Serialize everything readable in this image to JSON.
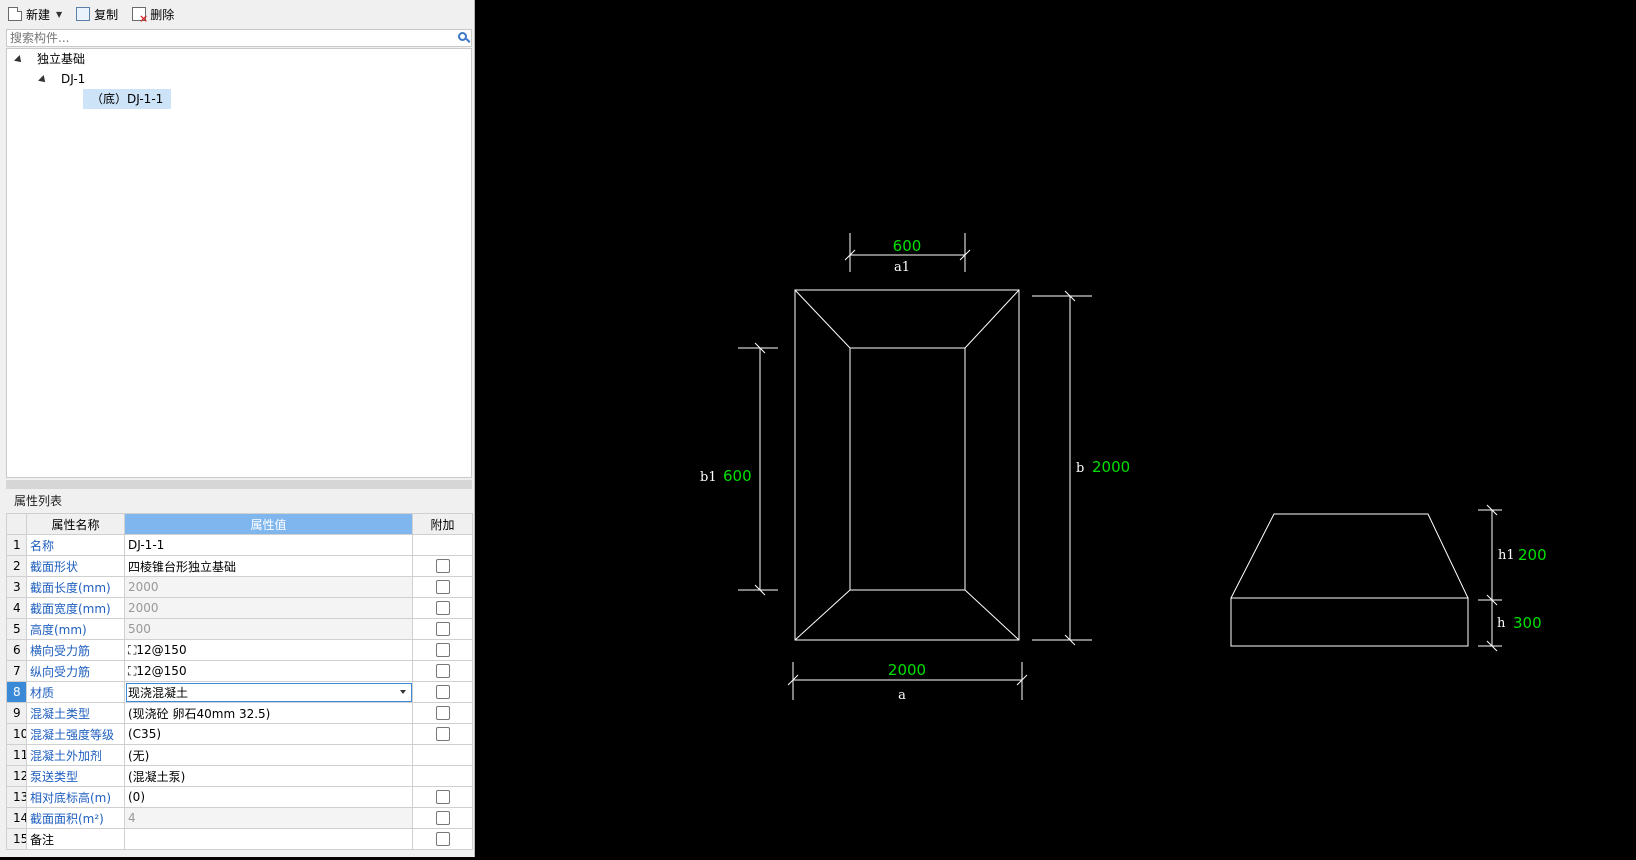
{
  "toolbar": {
    "new_label": "新建",
    "copy_label": "复制",
    "delete_label": "删除"
  },
  "search": {
    "placeholder": "搜索构件..."
  },
  "tree": {
    "root": "独立基础",
    "child": "DJ-1",
    "leaf": "（底）DJ-1-1"
  },
  "properties": {
    "title": "属性列表",
    "headers": {
      "name": "属性名称",
      "value": "属性值",
      "extra": "附加"
    },
    "rows": [
      {
        "num": "1",
        "name": "名称",
        "value": "DJ-1-1"
      },
      {
        "num": "2",
        "name": "截面形状",
        "value": "四棱锥台形独立基础"
      },
      {
        "num": "3",
        "name": "截面长度(mm)",
        "value": "2000"
      },
      {
        "num": "4",
        "name": "截面宽度(mm)",
        "value": "2000"
      },
      {
        "num": "5",
        "name": "高度(mm)",
        "value": "500"
      },
      {
        "num": "6",
        "name": "横向受力筋",
        "value": "⛶12@150"
      },
      {
        "num": "7",
        "name": "纵向受力筋",
        "value": "⛶12@150"
      },
      {
        "num": "8",
        "name": "材质",
        "value": "现浇混凝土"
      },
      {
        "num": "9",
        "name": "混凝土类型",
        "value": "(现浇砼 卵石40mm 32.5)"
      },
      {
        "num": "10",
        "name": "混凝土强度等级",
        "value": "(C35)"
      },
      {
        "num": "11",
        "name": "混凝土外加剂",
        "value": "(无)"
      },
      {
        "num": "12",
        "name": "泵送类型",
        "value": "(混凝土泵)"
      },
      {
        "num": "13",
        "name": "相对底标高(m)",
        "value": "(0)"
      },
      {
        "num": "14",
        "name": "截面面积(m²)",
        "value": "4"
      },
      {
        "num": "15",
        "name": "备注",
        "value": ""
      }
    ]
  },
  "drawing": {
    "a1_value": "600",
    "a1_label": "a1",
    "b1_label": "b1",
    "b1_value": "600",
    "b_label": "b",
    "b_value": "2000",
    "a_value": "2000",
    "a_label": "a",
    "h1_label": "h1",
    "h1_value": "200",
    "h_label": "h",
    "h_value": "300",
    "line_color": "#ffffff",
    "value_color": "#00e000"
  }
}
